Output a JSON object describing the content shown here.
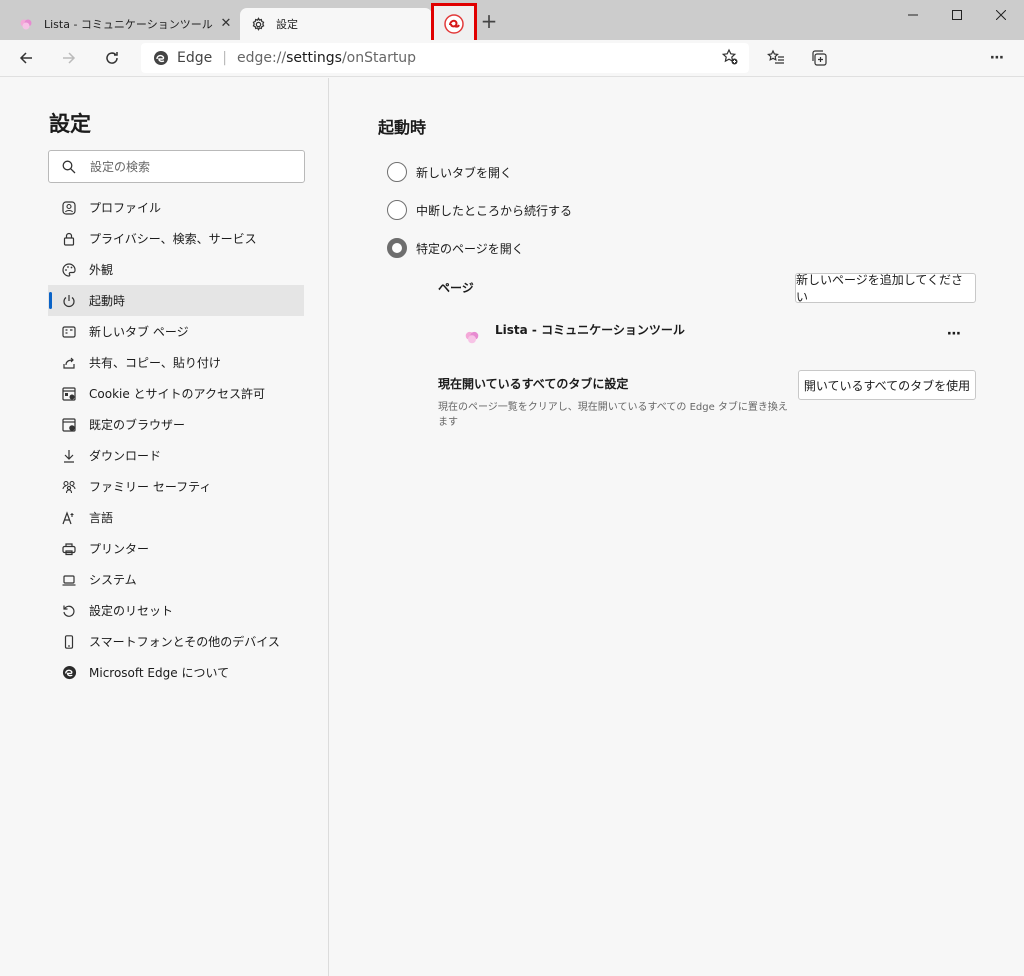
{
  "tabs": [
    {
      "title": "Lista - コミュニケーションツール",
      "close": "✕"
    },
    {
      "title": "設定",
      "close": ""
    }
  ],
  "new_tab": "+",
  "window_controls": {
    "minimize": "—",
    "maximize": "☐",
    "close": "✕"
  },
  "address_bar": {
    "brand": "Edge",
    "separator": "|",
    "url_scheme": "edge://",
    "url_host": "settings",
    "url_path": "/onStartup"
  },
  "toolbar": {
    "more": "⋯"
  },
  "sidebar": {
    "title": "設定",
    "search_placeholder": "設定の検索",
    "items": [
      {
        "label": "プロファイル",
        "icon": "profile-icon"
      },
      {
        "label": "プライバシー、検索、サービス",
        "icon": "lock-icon"
      },
      {
        "label": "外観",
        "icon": "appearance-icon"
      },
      {
        "label": "起動時",
        "icon": "power-icon",
        "active": true
      },
      {
        "label": "新しいタブ ページ",
        "icon": "newtab-icon"
      },
      {
        "label": "共有、コピー、貼り付け",
        "icon": "share-icon"
      },
      {
        "label": "Cookie とサイトのアクセス許可",
        "icon": "cookie-icon"
      },
      {
        "label": "既定のブラウザー",
        "icon": "browser-icon"
      },
      {
        "label": "ダウンロード",
        "icon": "download-icon"
      },
      {
        "label": "ファミリー セーフティ",
        "icon": "family-icon"
      },
      {
        "label": "言語",
        "icon": "language-icon"
      },
      {
        "label": "プリンター",
        "icon": "printer-icon"
      },
      {
        "label": "システム",
        "icon": "system-icon"
      },
      {
        "label": "設定のリセット",
        "icon": "reset-icon"
      },
      {
        "label": "スマートフォンとその他のデバイス",
        "icon": "phone-icon"
      },
      {
        "label": "Microsoft Edge について",
        "icon": "edge-icon"
      }
    ]
  },
  "main": {
    "title": "起動時",
    "options": [
      {
        "label": "新しいタブを開く",
        "checked": false
      },
      {
        "label": "中断したところから続行する",
        "checked": false
      },
      {
        "label": "特定のページを開く",
        "checked": true
      }
    ],
    "pages_label": "ページ",
    "add_page_button": "新しいページを追加してください",
    "page_entry": {
      "name": "Lista - コミュニケーションツール",
      "more": "⋯"
    },
    "set_current": {
      "title": "現在開いているすべてのタブに設定",
      "description": "現在のページ一覧をクリアし、現在開いているすべての Edge タブに置き換えます",
      "button": "開いているすべてのタブを使用"
    }
  }
}
